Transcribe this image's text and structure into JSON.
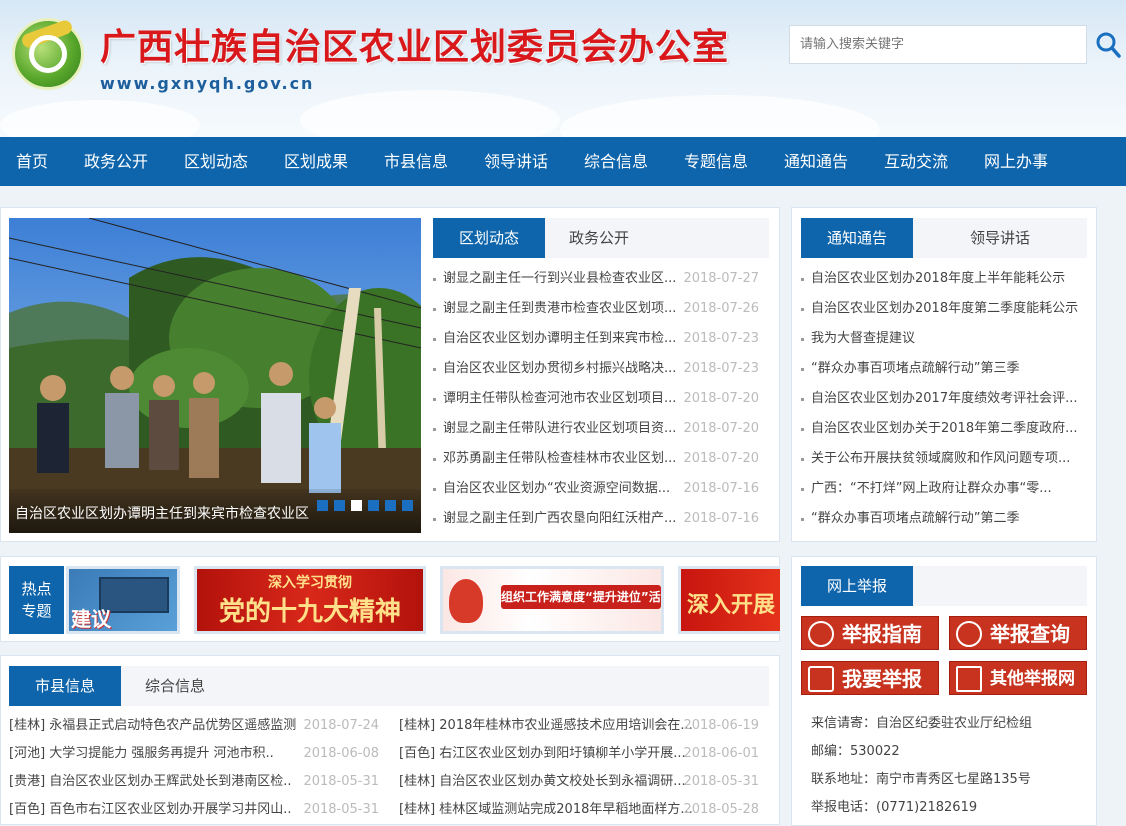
{
  "header": {
    "site_title": "广西壮族自治区农业区划委员会办公室",
    "site_url": "www.gxnyqh.gov.cn",
    "search_placeholder": "请输入搜索关键字"
  },
  "nav": [
    "首页",
    "政务公开",
    "区划动态",
    "区划成果",
    "市县信息",
    "领导讲话",
    "综合信息",
    "专题信息",
    "通知通告",
    "互动交流",
    "网上办事"
  ],
  "slider": {
    "caption": "自治区农业区划办谭明主任到来宾市检查农业区",
    "dots": 6,
    "active_dot": 3
  },
  "news_panel": {
    "tabs": [
      "区划动态",
      "政务公开"
    ],
    "items": [
      {
        "title": "谢显之副主任一行到兴业县检查农业区...",
        "date": "2018-07-27"
      },
      {
        "title": "谢显之副主任到贵港市检查农业区划项...",
        "date": "2018-07-26"
      },
      {
        "title": "自治区农业区划办谭明主任到来宾市检...",
        "date": "2018-07-23"
      },
      {
        "title": "自治区农业区划办贯彻乡村振兴战略决...",
        "date": "2018-07-23"
      },
      {
        "title": "谭明主任带队检查河池市农业区划项目...",
        "date": "2018-07-20"
      },
      {
        "title": "谢显之副主任带队进行农业区划项目资...",
        "date": "2018-07-20"
      },
      {
        "title": "邓苏勇副主任带队检查桂林市农业区划...",
        "date": "2018-07-20"
      },
      {
        "title": "自治区农业区划办“农业资源空间数据...",
        "date": "2018-07-16"
      },
      {
        "title": "谢显之副主任到广西农垦向阳红沃柑产...",
        "date": "2018-07-16"
      }
    ]
  },
  "notice_panel": {
    "tabs": [
      "通知通告",
      "领导讲话"
    ],
    "items": [
      "自治区农业区划办2018年度上半年能耗公示",
      "自治区农业区划办2018年度第二季度能耗公示",
      "我为大督查提建议",
      "“群众办事百项堵点疏解行动”第三季",
      "自治区农业区划办2017年度绩效考评社会评...",
      "自治区农业区划办关于2018年第二季度政府...",
      "关于公布开展扶贫领域腐败和作风问题专项...",
      "广西：“不打烊”网上政府让群众办事“零...",
      "“群众办事百项堵点疏解行动”第二季"
    ]
  },
  "hot_topics": {
    "label_line1": "热点",
    "label_line2": "专题",
    "banners": [
      "建议",
      "深入学习贯彻",
      "党的十九大精神",
      "组织工作满意度“提升进位”活动",
      "深入开展"
    ]
  },
  "county_panel": {
    "tabs": [
      "市县信息",
      "综合信息"
    ],
    "left": [
      {
        "title": "[桂林] 永福县正式启动特色农产品优势区遥感监测",
        "date": "2018-07-24"
      },
      {
        "title": "[河池] 大学习提能力 强服务再提升 河池市积..",
        "date": "2018-06-08"
      },
      {
        "title": "[贵港] 自治区农业区划办王辉武处长到港南区检..",
        "date": "2018-05-31"
      },
      {
        "title": "[百色] 百色市右江区农业区划办开展学习井冈山..",
        "date": "2018-05-31"
      }
    ],
    "right": [
      {
        "title": "[桂林] 2018年桂林市农业遥感技术应用培训会在...",
        "date": "2018-06-19"
      },
      {
        "title": "[百色] 右江区农业区划办到阳圩镇柳羊小学开展...",
        "date": "2018-06-01"
      },
      {
        "title": "[桂林] 自治区农业区划办黄文校处长到永福调研...",
        "date": "2018-05-31"
      },
      {
        "title": "[桂林] 桂林区域监测站完成2018年早稻地面样方...",
        "date": "2018-05-28"
      }
    ]
  },
  "report_panel": {
    "tab": "网上举报",
    "buttons": [
      "举报指南",
      "举报查询",
      "我要举报",
      "其他举报网站"
    ],
    "info": [
      "来信请寄：自治区纪委驻农业厅纪检组",
      "邮编：530022",
      "联系地址：南宁市青秀区七星路135号",
      "举报电话：(0771)2182619"
    ]
  },
  "colors": {
    "nav": "#0e65ac",
    "title": "#d8181b",
    "report": "#c8331f"
  }
}
